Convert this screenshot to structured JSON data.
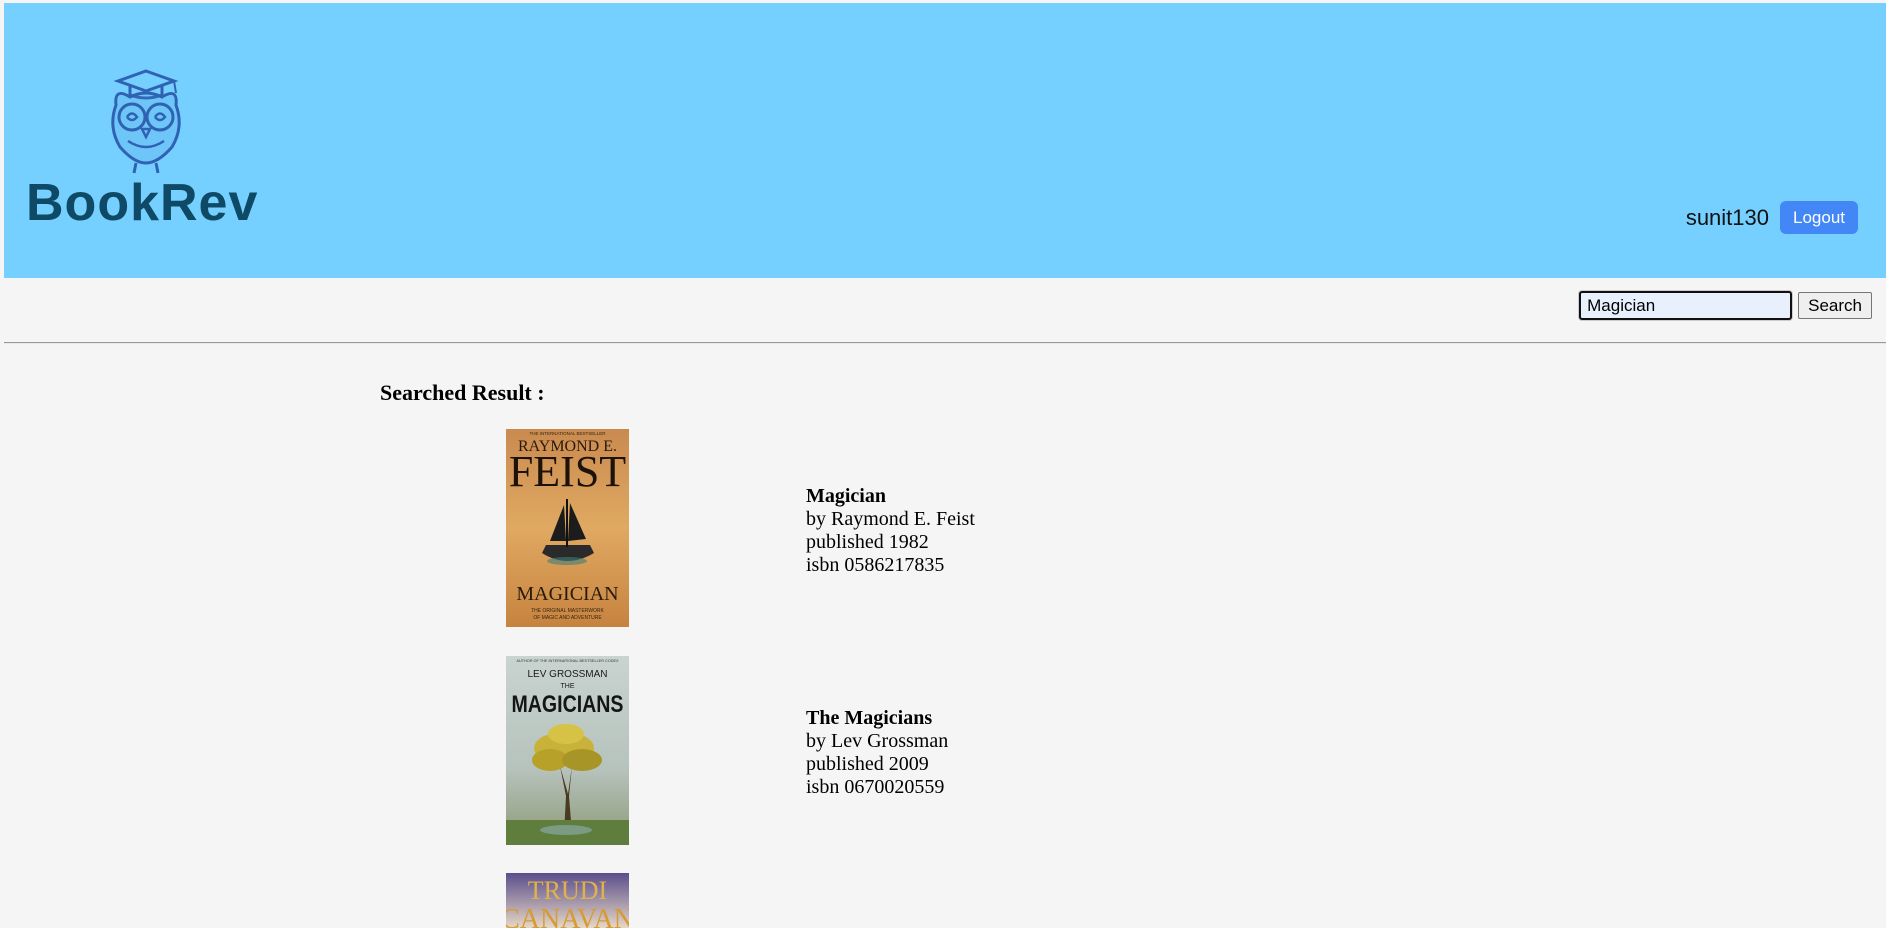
{
  "header": {
    "brand": "BookRev",
    "username": "sunit130",
    "logout_label": "Logout"
  },
  "search": {
    "value": "Magician",
    "button_label": "Search"
  },
  "results": {
    "heading": "Searched Result :",
    "books": [
      {
        "title": "Magician",
        "author": "by Raymond E. Feist",
        "published": "published 1982",
        "isbn": "isbn 0586217835",
        "cover": {
          "tagline": "THE INTERNATIONAL BESTSELLER",
          "author_top": "RAYMOND E.",
          "author_bottom": "FEIST",
          "title": "MAGICIAN",
          "subtitle_1": "THE ORIGINAL MASTERWORK",
          "subtitle_2": "OF MAGIC AND ADVENTURE"
        }
      },
      {
        "title": "The Magicians",
        "author": "by Lev Grossman",
        "published": "published 2009",
        "isbn": "isbn 0670020559",
        "cover": {
          "tagline": "AUTHOR OF THE INTERNATIONAL BESTSELLER CODEX",
          "author": "LEV GROSSMAN",
          "the": "THE",
          "title": "MAGICIANS"
        }
      },
      {
        "cover": {
          "author_top": "TRUDI",
          "author_bottom": "CANAVAN"
        }
      }
    ]
  },
  "colors": {
    "header_bg": "#75d0ff",
    "logo_text": "#0e4a66",
    "logout_bg": "#4287f5",
    "page_bg": "#f5f5f5"
  },
  "icons": {
    "logo": "owl-graduate-icon"
  }
}
